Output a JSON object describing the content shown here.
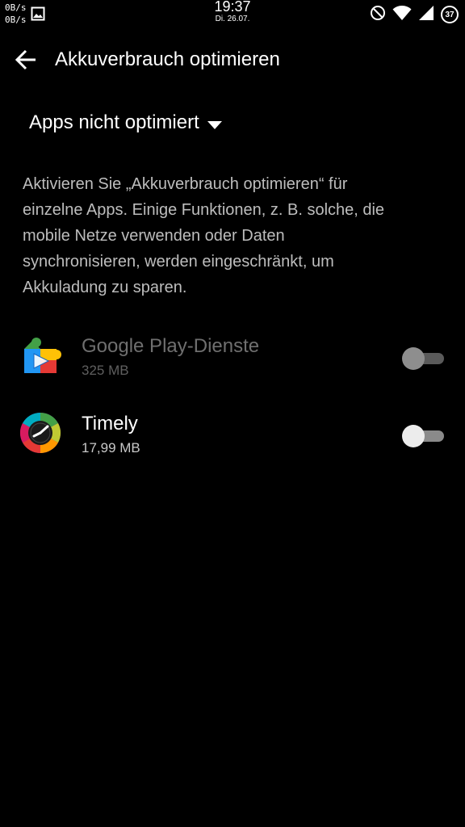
{
  "status_bar": {
    "upload_speed": "0B/s",
    "download_speed": "0B/s",
    "time": "19:37",
    "date": "Di. 26.07.",
    "battery_level": "37",
    "icons": [
      "image-icon",
      "dnd-icon",
      "wifi-icon",
      "signal-icon",
      "battery-icon"
    ]
  },
  "toolbar": {
    "title": "Akkuverbrauch optimieren",
    "back_icon": "arrow-back-icon"
  },
  "filter": {
    "selected": "Apps nicht optimiert"
  },
  "description": "Aktivieren Sie „Akkuverbrauch optimieren“ für einzelne Apps. Einige Funktionen, z. B. solche, die mobile Netze verwenden oder Daten synchronisieren, werden eingeschränkt, um Akkuladung zu sparen.",
  "apps": [
    {
      "name": "Google Play-Dienste",
      "size": "325 MB",
      "enabled": false,
      "disabled_row": true,
      "icon": "google-play-services-icon"
    },
    {
      "name": "Timely",
      "size": "17,99 MB",
      "enabled": false,
      "disabled_row": false,
      "icon": "timely-icon"
    }
  ],
  "colors": {
    "background": "#000000",
    "text_primary": "#ffffff",
    "text_secondary": "#bdbdbd",
    "text_disabled": "#6f6f6f"
  }
}
